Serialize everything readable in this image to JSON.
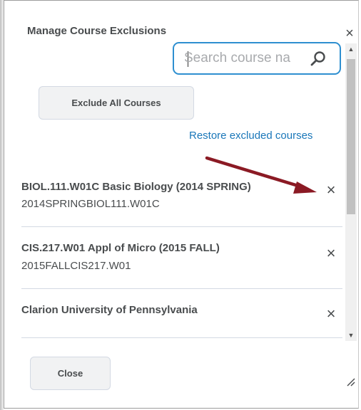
{
  "dialog": {
    "title": "Manage Course Exclusions",
    "close_glyph": "×"
  },
  "search": {
    "placeholder": "Search course na",
    "value": ""
  },
  "buttons": {
    "exclude_all": "Exclude All Courses",
    "close": "Close"
  },
  "restore_link": "Restore excluded courses",
  "courses": [
    {
      "title": "BIOL.111.W01C Basic Biology (2014 SPRING)",
      "code": "2014SPRINGBIOL111.W01C",
      "remove_glyph": "×"
    },
    {
      "title": "CIS.217.W01 Appl of Micro (2015 FALL)",
      "code": "2015FALLCIS217.W01",
      "remove_glyph": "×"
    },
    {
      "title": "Clarion University of Pennsylvania",
      "code": "",
      "remove_glyph": "×"
    }
  ],
  "colors": {
    "accent": "#2e8fd0",
    "link": "#1a77b9",
    "annotation_arrow": "#8b1a24",
    "text": "#494c4e"
  },
  "icons": {
    "search": "search-icon",
    "close": "close-icon",
    "remove": "remove-icon",
    "resize": "resize-grip-icon"
  }
}
